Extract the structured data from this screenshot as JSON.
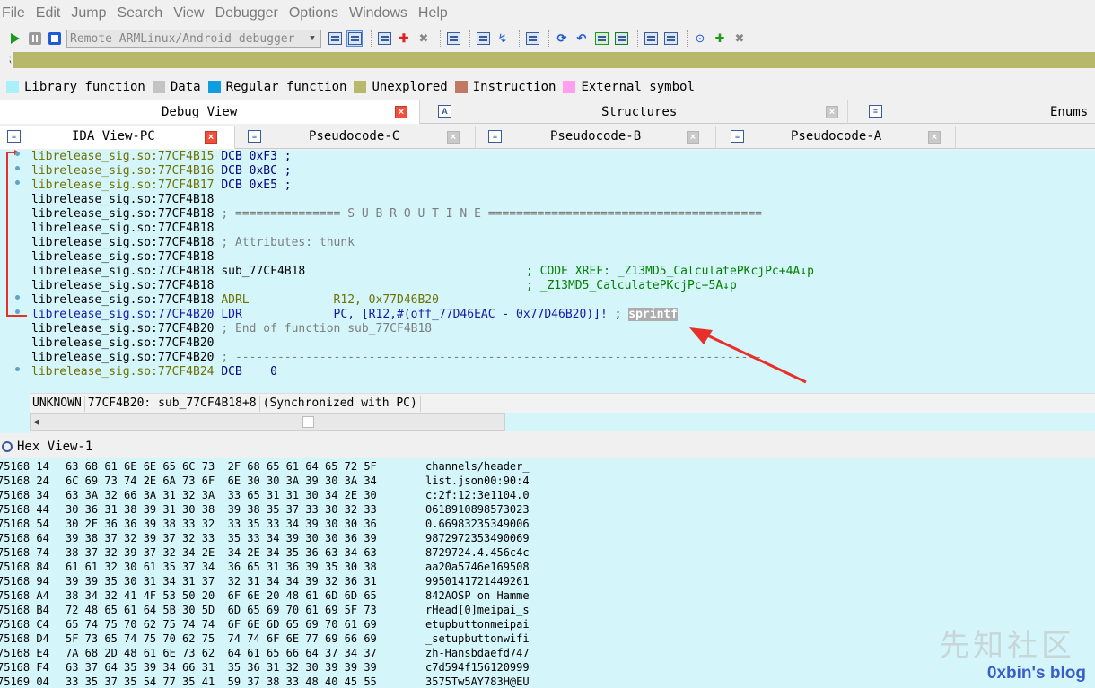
{
  "menu": [
    "File",
    "Edit",
    "Jump",
    "Search",
    "View",
    "Debugger",
    "Options",
    "Windows",
    "Help"
  ],
  "toolbar": {
    "debugger_select": "Remote ARMLinux/Android debugger"
  },
  "legend": [
    {
      "label": "Library function",
      "color": "#aaf0f8"
    },
    {
      "label": "Data",
      "color": "#c4c4c4"
    },
    {
      "label": "Regular function",
      "color": "#0e9de0"
    },
    {
      "label": "Unexplored",
      "color": "#b8b86a"
    },
    {
      "label": "Instruction",
      "color": "#bf7a64"
    },
    {
      "label": "External symbol",
      "color": "#ff9ff0"
    }
  ],
  "tabs_top": {
    "debug_view": "Debug View",
    "structures": "Structures",
    "enums": "Enums"
  },
  "tabs_sub": {
    "ida_view": "IDA View-PC",
    "pseudo_c": "Pseudocode-C",
    "pseudo_b": "Pseudocode-B",
    "pseudo_a": "Pseudocode-A"
  },
  "disasm": {
    "lines": [
      {
        "addr": "librelease_sig.so:77CF4B15",
        "rest": " DCB 0xF3 ;"
      },
      {
        "addr": "librelease_sig.so:77CF4B16",
        "rest": " DCB 0xBC ;"
      },
      {
        "addr": "librelease_sig.so:77CF4B17",
        "rest": " DCB 0xE5 ;"
      },
      {
        "addr": "librelease_sig.so:77CF4B18",
        "rest": ""
      },
      {
        "addr": "librelease_sig.so:77CF4B18",
        "rest": " ; =============== S U B R O U T I N E ======================================="
      },
      {
        "addr": "librelease_sig.so:77CF4B18",
        "rest": ""
      },
      {
        "addr": "librelease_sig.so:77CF4B18",
        "rest": " ; Attributes: thunk"
      },
      {
        "addr": "librelease_sig.so:77CF4B18",
        "rest": ""
      },
      {
        "addr": "librelease_sig.so:77CF4B18",
        "rest": " sub_77CF4B18"
      },
      {
        "addr": "librelease_sig.so:77CF4B18",
        "rest": ""
      },
      {
        "addr": "librelease_sig.so:77CF4B18",
        "rest": " ADRL            R12, 0x77D46B20"
      },
      {
        "addr": "librelease_sig.so:77CF4B20",
        "rest": " LDR             PC, [R12,#(off_77D46EAC - 0x77D46B20)]! ;"
      },
      {
        "addr": "librelease_sig.so:77CF4B20",
        "rest": " ; End of function sub_77CF4B18"
      },
      {
        "addr": "librelease_sig.so:77CF4B20",
        "rest": ""
      },
      {
        "addr": "librelease_sig.so:77CF4B20",
        "rest": " ; ---------------------------------------------------------------------------"
      },
      {
        "addr": "librelease_sig.so:77CF4B24",
        "rest": " DCB    0"
      }
    ],
    "xref1": "; CODE XREF: _Z13MD5_CalculatePKcjPc+4A↓p",
    "xref2": "; _Z13MD5_CalculatePKcjPc+5A↓p",
    "highlight_symbol": "sprintf",
    "status": [
      "UNKNOWN",
      "77CF4B20: sub_77CF4B18+8",
      "(Synchronized with PC)"
    ]
  },
  "hex": {
    "title": "Hex View-1",
    "rows": [
      {
        "addr": "75168 14",
        "bytes": "63 68 61 6E 6E 65 6C 73  2F 68 65 61 64 65 72 5F",
        "ascii": "channels/header_"
      },
      {
        "addr": "75168 24",
        "bytes": "6C 69 73 74 2E 6A 73 6F  6E 30 30 3A 39 30 3A 34",
        "ascii": "list.json00:90:4"
      },
      {
        "addr": "75168 34",
        "bytes": "63 3A 32 66 3A 31 32 3A  33 65 31 31 30 34 2E 30",
        "ascii": "c:2f:12:3e1104.0"
      },
      {
        "addr": "75168 44",
        "bytes": "30 36 31 38 39 31 30 38  39 38 35 37 33 30 32 33",
        "ascii": "0618910898573023"
      },
      {
        "addr": "75168 54",
        "bytes": "30 2E 36 36 39 38 33 32  33 35 33 34 39 30 30 36",
        "ascii": "0.66983235349006"
      },
      {
        "addr": "75168 64",
        "bytes": "39 38 37 32 39 37 32 33  35 33 34 39 30 30 36 39",
        "ascii": "9872972353490069"
      },
      {
        "addr": "75168 74",
        "bytes": "38 37 32 39 37 32 34 2E  34 2E 34 35 36 63 34 63",
        "ascii": "8729724.4.456c4c"
      },
      {
        "addr": "75168 84",
        "bytes": "61 61 32 30 61 35 37 34  36 65 31 36 39 35 30 38",
        "ascii": "aa20a5746e169508"
      },
      {
        "addr": "75168 94",
        "bytes": "39 39 35 30 31 34 31 37  32 31 34 34 39 32 36 31",
        "ascii": "9950141721449261"
      },
      {
        "addr": "75168 A4",
        "bytes": "38 34 32 41 4F 53 50 20  6F 6E 20 48 61 6D 6D 65",
        "ascii": "842AOSP on Hamme"
      },
      {
        "addr": "75168 B4",
        "bytes": "72 48 65 61 64 5B 30 5D  6D 65 69 70 61 69 5F 73",
        "ascii": "rHead[0]meipai_s"
      },
      {
        "addr": "75168 C4",
        "bytes": "65 74 75 70 62 75 74 74  6F 6E 6D 65 69 70 61 69",
        "ascii": "etupbuttonmeipai"
      },
      {
        "addr": "75168 D4",
        "bytes": "5F 73 65 74 75 70 62 75  74 74 6F 6E 77 69 66 69",
        "ascii": "_setupbuttonwifi"
      },
      {
        "addr": "75168 E4",
        "bytes": "7A 68 2D 48 61 6E 73 62  64 61 65 66 64 37 34 37",
        "ascii": "zh-Hansbdaefd747"
      },
      {
        "addr": "75168 F4",
        "bytes": "63 37 64 35 39 34 66 31  35 36 31 32 30 39 39 39",
        "ascii": "c7d594f156120999"
      },
      {
        "addr": "75169 04",
        "bytes": "33 35 37 35 54 77 35 41  59 37 38 33 48 40 45 55",
        "ascii": "3575Tw5AY783H@EU"
      }
    ]
  },
  "watermark": "先知社区",
  "blog_label": "0xbin's blog",
  "accents": {
    "arrow_red": "#e8302a",
    "disasm_bg": "#d4f6fb"
  }
}
